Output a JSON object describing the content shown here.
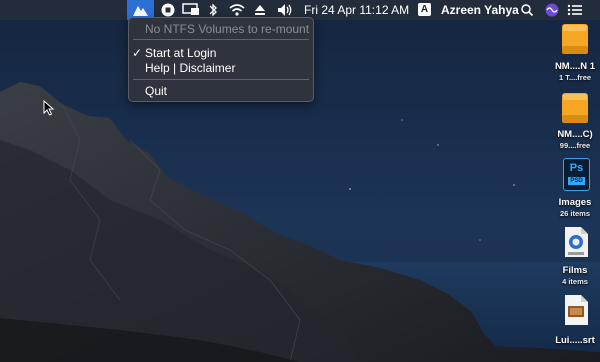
{
  "menubar": {
    "clock": "Fri 24 Apr  11:12 AM",
    "input_source": "A",
    "user": "Azreen Yahya"
  },
  "menu": {
    "status": "No NTFS Volumes to re-mount",
    "start_at_login": "Start at Login",
    "check_mark": "✓",
    "help": "Help | Disclaimer",
    "quit": "Quit"
  },
  "desktop_items": [
    {
      "name": "NM....N 1",
      "info": "1 T....free"
    },
    {
      "name": "NM....C)",
      "info": "99....free"
    },
    {
      "name": "Images",
      "info": "26 items"
    },
    {
      "name": "Films",
      "info": "4 items"
    },
    {
      "name": "Lui.....srt",
      "info": ""
    }
  ],
  "icons": {
    "app": "ntfs-mounter-icon",
    "ps_badge": "Ps",
    "psd_label": "PSD"
  },
  "colors": {
    "menubar_bg": "#242c3a",
    "menu_bg": "#30343c",
    "app_highlight": "#2e6fd6",
    "drive_orange": "#f5a623"
  }
}
